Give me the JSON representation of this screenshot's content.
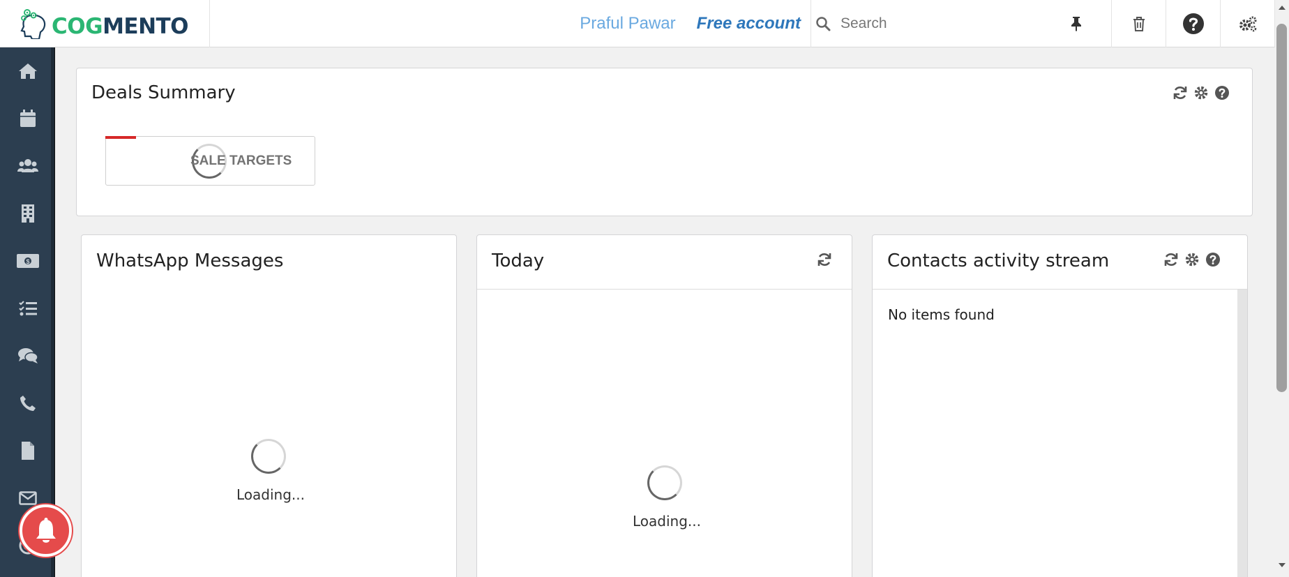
{
  "header": {
    "logo_prefix": "COG",
    "logo_suffix": "MENTO",
    "user_name": "Praful Pawar",
    "account_type": "Free account",
    "search_placeholder": "Search"
  },
  "sidebar": {
    "items": [
      {
        "icon": "home-icon"
      },
      {
        "icon": "calendar-icon"
      },
      {
        "icon": "contacts-icon"
      },
      {
        "icon": "companies-icon"
      },
      {
        "icon": "deals-icon"
      },
      {
        "icon": "tasks-icon"
      },
      {
        "icon": "cases-icon"
      },
      {
        "icon": "calls-icon"
      },
      {
        "icon": "documents-icon"
      },
      {
        "icon": "email-icon"
      },
      {
        "icon": "campaigns-icon"
      }
    ]
  },
  "deals_summary": {
    "title": "Deals Summary",
    "sale_targets_label": "SALE TARGETS"
  },
  "whatsapp": {
    "title": "WhatsApp Messages",
    "loading": "Loading..."
  },
  "today": {
    "title": "Today",
    "loading": "Loading..."
  },
  "contacts_stream": {
    "title": "Contacts activity stream",
    "empty": "No items found"
  },
  "colors": {
    "sidebar_bg": "#2c3e50",
    "logo_green": "#2bb673",
    "logo_navy": "#1c3d5a",
    "user_name": "#6aa9e0",
    "account_type": "#2e77bb",
    "notification_red": "#e54b4b",
    "sale_bar_red": "#d62828"
  }
}
